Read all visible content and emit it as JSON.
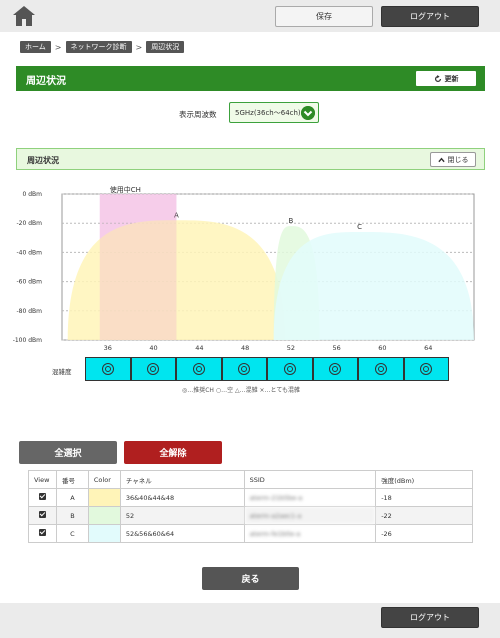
{
  "topbar": {
    "save_label": "保存",
    "logout_label": "ログアウト"
  },
  "breadcrumb": [
    "ホーム",
    "ネットワーク診断",
    "周辺状況"
  ],
  "title": "周辺状況",
  "refresh_label": "更新",
  "band": {
    "label": "表示周波数",
    "value": "5GHz(36ch～64ch)"
  },
  "section": {
    "title": "周辺状況",
    "close_label": "閉じる"
  },
  "chart_data": {
    "type": "area",
    "x": [
      36,
      40,
      44,
      48,
      52,
      56,
      60,
      64
    ],
    "xlim": [
      32,
      68
    ],
    "ylim": [
      -100,
      0
    ],
    "y_ticks": [
      0,
      -20,
      -40,
      -60,
      -80,
      -100
    ],
    "y_tick_labels": [
      "0 dBm",
      "-20 dBm",
      "-40 dBm",
      "-60 dBm",
      "-80 dBm",
      "-100 dBm"
    ],
    "grid": true,
    "in_use_label": "使用中CH",
    "in_use_range": [
      36,
      42
    ],
    "series": [
      {
        "name": "A",
        "color": "#fff4b8",
        "x_range": [
          32.5,
          51.5
        ],
        "peak_x": 42,
        "peak": -18
      },
      {
        "name": "B",
        "color": "#e2f9dd",
        "x_range": [
          50.5,
          54.5
        ],
        "peak_x": 52,
        "peak": -22
      },
      {
        "name": "C",
        "color": "#e2fbfc",
        "x_range": [
          50.5,
          68
        ],
        "peak_x": 58,
        "peak": -26
      }
    ]
  },
  "congestion": {
    "label": "混雑度",
    "cells": [
      "◎",
      "◎",
      "◎",
      "◎",
      "◎",
      "◎",
      "◎",
      "◎"
    ],
    "note": "◎…推奨CH ○…空 △…混雑 ×…とても混雑"
  },
  "buttons": {
    "select_all": "全選択",
    "deselect_all": "全解除",
    "back": "戻る",
    "logout": "ログアウト"
  },
  "table": {
    "headers": [
      "View",
      "番号",
      "Color",
      "チャネル",
      "SSID",
      "強度(dBm)"
    ],
    "rows": [
      {
        "id": "A",
        "color": "#fff4b8",
        "channel": "36&40&44&48",
        "ssid": "aterm-21b5be-a",
        "strength": "-18"
      },
      {
        "id": "B",
        "color": "#e2f9dd",
        "channel": "52",
        "ssid": "aterm-a2aec1-a",
        "strength": "-22"
      },
      {
        "id": "C",
        "color": "#e2fbfc",
        "channel": "52&56&60&64",
        "ssid": "aterm-fe1b0e-a",
        "strength": "-26"
      }
    ]
  }
}
